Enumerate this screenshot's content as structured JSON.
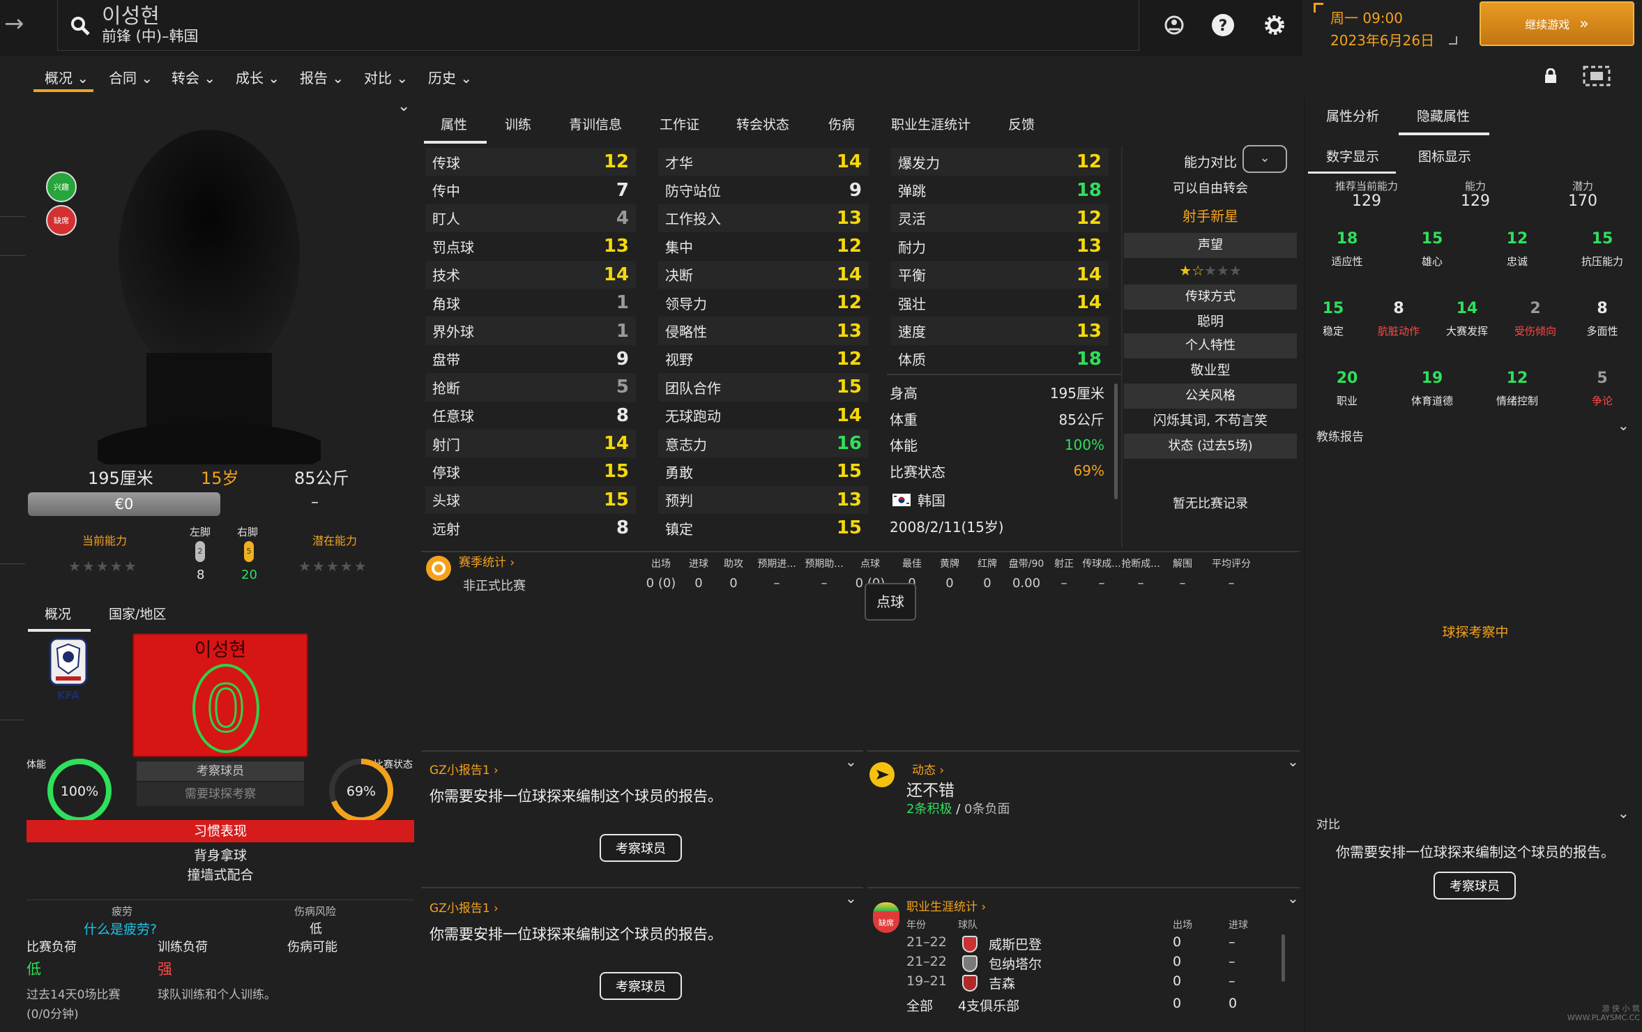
{
  "header": {
    "back_arrow": "→",
    "player_name": "이성현",
    "player_role": "前锋 (中)–韩国",
    "date_day": "周一 09:00",
    "date_date": "2023年6月26日",
    "continue_label": "继续游戏"
  },
  "menu": [
    "概况",
    "合同",
    "转会",
    "成长",
    "报告",
    "对比",
    "历史"
  ],
  "badges": {
    "interest": "兴趣",
    "absent": "缺席"
  },
  "profile": {
    "height": "195厘米",
    "age": "15岁",
    "weight": "85公斤",
    "value": "€0",
    "dash": "–",
    "current_ability": "当前能力",
    "potential_ability": "潜在能力",
    "left_foot": "左脚",
    "right_foot": "右脚",
    "left_foot_icon_num": "2",
    "right_foot_icon_num": "5",
    "left_foot_val": "8",
    "right_foot_val": "20"
  },
  "left_tabs": [
    "概况",
    "国家/地区"
  ],
  "kit": {
    "name": "이성현",
    "number": "0",
    "federation": "KFA"
  },
  "scout": {
    "label": "考察球员",
    "need": "需要球探考察"
  },
  "gauges": {
    "fitness_label": "体能",
    "fitness_val": "100%",
    "match_label": "比赛状态",
    "match_val": "69%",
    "fitness_level": 1.0,
    "match_level": 0.69
  },
  "habits": {
    "title": "习惯表现",
    "items": [
      "背身拿球",
      "撞墙式配合"
    ]
  },
  "injury": {
    "fatigue": "疲劳",
    "what_fatigue": "什么是疲劳?",
    "injury_risk": "伤病风险",
    "risk_val": "低",
    "match_load": "比赛负荷",
    "training_load": "训练负荷",
    "injury_chance": "伤病可能",
    "match_load_val": "低",
    "training_load_val": "强",
    "note1": "过去14天0场比赛",
    "note2": "(0/0分钟)",
    "note3": "球队训练和个人训练。"
  },
  "tabs": [
    "属性",
    "训练",
    "青训信息",
    "工作证",
    "转会状态",
    "伤病",
    "职业生涯统计",
    "反馈"
  ],
  "attributes": {
    "technical": [
      {
        "n": "传球",
        "v": "12",
        "c": "yel"
      },
      {
        "n": "传中",
        "v": "7",
        "c": ""
      },
      {
        "n": "盯人",
        "v": "4",
        "c": "gry"
      },
      {
        "n": "罚点球",
        "v": "13",
        "c": "yel"
      },
      {
        "n": "技术",
        "v": "14",
        "c": "yel"
      },
      {
        "n": "角球",
        "v": "1",
        "c": "gry"
      },
      {
        "n": "界外球",
        "v": "1",
        "c": "gry"
      },
      {
        "n": "盘带",
        "v": "9",
        "c": ""
      },
      {
        "n": "抢断",
        "v": "5",
        "c": "gry"
      },
      {
        "n": "任意球",
        "v": "8",
        "c": ""
      },
      {
        "n": "射门",
        "v": "14",
        "c": "yel"
      },
      {
        "n": "停球",
        "v": "15",
        "c": "yel"
      },
      {
        "n": "头球",
        "v": "15",
        "c": "yel"
      },
      {
        "n": "远射",
        "v": "8",
        "c": ""
      }
    ],
    "mental": [
      {
        "n": "才华",
        "v": "14",
        "c": "yel"
      },
      {
        "n": "防守站位",
        "v": "9",
        "c": ""
      },
      {
        "n": "工作投入",
        "v": "13",
        "c": "yel"
      },
      {
        "n": "集中",
        "v": "12",
        "c": "yel"
      },
      {
        "n": "决断",
        "v": "14",
        "c": "yel"
      },
      {
        "n": "领导力",
        "v": "12",
        "c": "yel"
      },
      {
        "n": "侵略性",
        "v": "13",
        "c": "yel"
      },
      {
        "n": "视野",
        "v": "12",
        "c": "yel"
      },
      {
        "n": "团队合作",
        "v": "15",
        "c": "yel"
      },
      {
        "n": "无球跑动",
        "v": "14",
        "c": "yel"
      },
      {
        "n": "意志力",
        "v": "16",
        "c": "grn"
      },
      {
        "n": "勇敢",
        "v": "15",
        "c": "yel"
      },
      {
        "n": "预判",
        "v": "13",
        "c": "yel"
      },
      {
        "n": "镇定",
        "v": "15",
        "c": "yel"
      }
    ],
    "physical": [
      {
        "n": "爆发力",
        "v": "12",
        "c": "yel"
      },
      {
        "n": "弹跳",
        "v": "18",
        "c": "grn"
      },
      {
        "n": "灵活",
        "v": "12",
        "c": "yel"
      },
      {
        "n": "耐力",
        "v": "13",
        "c": "yel"
      },
      {
        "n": "平衡",
        "v": "14",
        "c": "yel"
      },
      {
        "n": "强壮",
        "v": "14",
        "c": "yel"
      },
      {
        "n": "速度",
        "v": "13",
        "c": "yel"
      },
      {
        "n": "体质",
        "v": "18",
        "c": "grn"
      }
    ]
  },
  "info": [
    {
      "n": "身高",
      "v": "195厘米",
      "c": ""
    },
    {
      "n": "体重",
      "v": "85公斤",
      "c": ""
    },
    {
      "n": "体能",
      "v": "100%",
      "c": "grn"
    },
    {
      "n": "比赛状态",
      "v": "69%",
      "c": "org"
    }
  ],
  "nation": "韩国",
  "birth": "2008/2/11(15岁)",
  "mid": {
    "compare": "能力对比",
    "free_transfer": "可以自由转会",
    "tag": "射手新星",
    "reputation": "声望",
    "passing_style": "传球方式",
    "passing_val": "聪明",
    "personality": "个人特性",
    "personality_val": "敬业型",
    "media": "公关风格",
    "media_val": "闪烁其词, 不苟言笑",
    "form": "状态 (过去5场)",
    "no_match": "暂无比赛记录",
    "reputation_stars": 1.5
  },
  "season": {
    "title": "赛季统计",
    "headers": [
      "出场",
      "进球",
      "助攻",
      "预期进...",
      "预期助...",
      "点球",
      "最佳",
      "黄牌",
      "红牌",
      "盘带/90",
      "射正",
      "传球成...",
      "抢断成...",
      "解围",
      "平均评分"
    ],
    "row_label": "非正式比赛",
    "row": [
      "0 (0)",
      "0",
      "0",
      "–",
      "–",
      "0 (0)",
      "0",
      "0",
      "0",
      "0.00",
      "–",
      "–",
      "–",
      "–",
      "–"
    ],
    "tooltip": "点球"
  },
  "reports": {
    "link": "GZ小报告1",
    "text": "你需要安排一位球探来编制这个球员的报告。",
    "button": "考察球员"
  },
  "dynamics": {
    "title": "动态",
    "status": "还不错",
    "pos": "2条积极",
    "sep": "/",
    "neg": "0条负面"
  },
  "career": {
    "title": "职业生涯统计",
    "badge": "缺席",
    "headers": [
      "年份",
      "球队",
      "出场",
      "进球"
    ],
    "rows": [
      {
        "y": "21–22",
        "t": "威斯巴登",
        "a": "0",
        "g": "–"
      },
      {
        "y": "21–22",
        "t": "包纳塔尔",
        "a": "0",
        "g": "–"
      },
      {
        "y": "19–21",
        "t": "吉森",
        "a": "0",
        "g": "–"
      }
    ],
    "total": {
      "y": "全部",
      "t": "4支俱乐部",
      "a": "0",
      "g": "0"
    }
  },
  "right": {
    "tabs": [
      "属性分析",
      "隐藏属性"
    ],
    "subtabs": [
      "数字显示",
      "图标显示"
    ],
    "top": [
      {
        "l": "推荐当前能力",
        "v": "129"
      },
      {
        "l": "能力",
        "v": "129"
      },
      {
        "l": "潜力",
        "v": "170"
      }
    ],
    "hidden": [
      {
        "v": "18",
        "l": "适应性",
        "vc": "grn",
        "lc": ""
      },
      {
        "v": "15",
        "l": "雄心",
        "vc": "grn",
        "lc": ""
      },
      {
        "v": "12",
        "l": "忠诚",
        "vc": "grn",
        "lc": ""
      },
      {
        "v": "15",
        "l": "抗压能力",
        "vc": "grn",
        "lc": ""
      },
      {
        "v": "15",
        "l": "稳定",
        "vc": "grn",
        "lc": ""
      },
      {
        "v": "8",
        "l": "肮脏动作",
        "vc": "",
        "lc": "red"
      },
      {
        "v": "14",
        "l": "大赛发挥",
        "vc": "grn",
        "lc": ""
      },
      {
        "v": "2",
        "l": "受伤倾向",
        "vc": "gry",
        "lc": "red"
      },
      {
        "v": "8",
        "l": "多面性",
        "vc": "",
        "lc": ""
      },
      {
        "v": "20",
        "l": "职业",
        "vc": "grn",
        "lc": ""
      },
      {
        "v": "19",
        "l": "体育道德",
        "vc": "grn",
        "lc": ""
      },
      {
        "v": "12",
        "l": "情绪控制",
        "vc": "grn",
        "lc": ""
      },
      {
        "v": "5",
        "l": "争论",
        "vc": "gry",
        "lc": "red"
      }
    ],
    "coach_report": "教练报告",
    "scouting": "球探考察中",
    "compare": "对比",
    "compare_text": "你需要安排一位球探来编制这个球员的报告。",
    "compare_btn": "考察球员"
  },
  "watermark": "游 侠 小 筑\nWWW.PLAYSMC.CC"
}
